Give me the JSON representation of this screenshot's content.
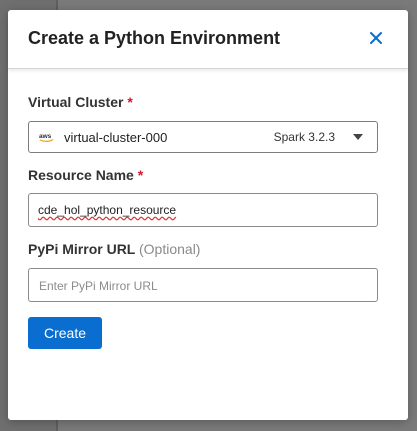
{
  "dialog": {
    "title": "Create a Python Environment",
    "close_icon": "close-icon"
  },
  "virtual_cluster": {
    "label": "Virtual Cluster",
    "required_mark": "*",
    "provider_icon": "aws-logo-icon",
    "selected_value": "virtual-cluster-000",
    "spark_version": "Spark 3.2.3"
  },
  "resource_name": {
    "label": "Resource Name",
    "required_mark": "*",
    "value": "cde_hol_python_resource"
  },
  "pypi_mirror": {
    "label": "PyPi Mirror URL",
    "optional_text": "(Optional)",
    "placeholder": "Enter PyPi Mirror URL",
    "value": ""
  },
  "actions": {
    "create_label": "Create"
  },
  "colors": {
    "primary_button": "#0a6ed1",
    "required": "#d0182b",
    "close_icon": "#0a6ed1"
  }
}
